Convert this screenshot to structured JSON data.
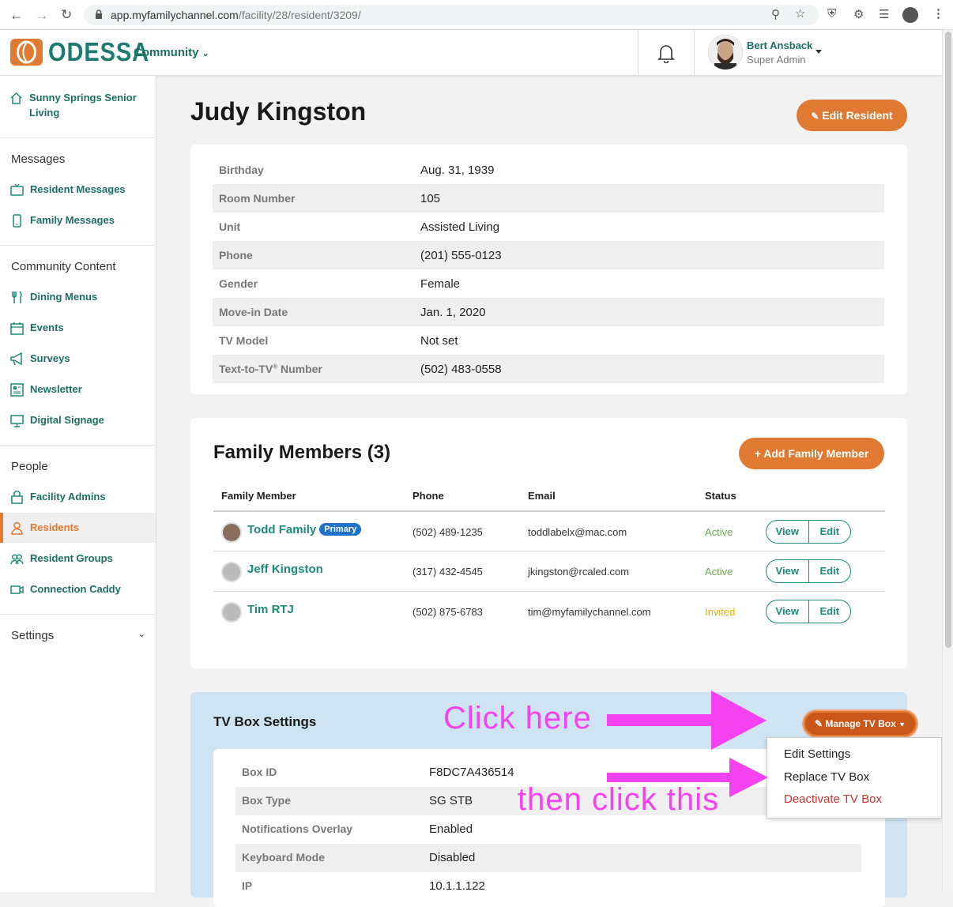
{
  "browser": {
    "url_host": "app.myfamilychannel.com",
    "url_path": "/facility/28/resident/3209/"
  },
  "header": {
    "logo_text": "ODESSA",
    "community_label": "Community",
    "user_name": "Bert Ansback",
    "user_role": "Super Admin"
  },
  "sidebar": {
    "facility": "Sunny Springs Senior Living",
    "sections": {
      "messages": "Messages",
      "community_content": "Community Content",
      "people": "People",
      "settings": "Settings"
    },
    "items": {
      "resident_messages": "Resident Messages",
      "family_messages": "Family Messages",
      "dining_menus": "Dining Menus",
      "events": "Events",
      "surveys": "Surveys",
      "newsletter": "Newsletter",
      "digital_signage": "Digital Signage",
      "facility_admins": "Facility Admins",
      "residents": "Residents",
      "resident_groups": "Resident Groups",
      "connection_caddy": "Connection Caddy"
    }
  },
  "resident": {
    "name": "Judy Kingston",
    "edit_button": "Edit Resident",
    "fields": [
      {
        "label": "Birthday",
        "value": "Aug. 31, 1939"
      },
      {
        "label": "Room Number",
        "value": "105"
      },
      {
        "label": "Unit",
        "value": "Assisted Living"
      },
      {
        "label": "Phone",
        "value": "(201) 555-0123"
      },
      {
        "label": "Gender",
        "value": "Female"
      },
      {
        "label": "Move-in Date",
        "value": "Jan. 1, 2020"
      },
      {
        "label": "TV Model",
        "value": "Not set"
      },
      {
        "label": "Text-to-TV",
        "label_sup": "®",
        "label_suffix": " Number",
        "value": "(502) 483-0558"
      }
    ]
  },
  "family": {
    "title": "Family Members (3)",
    "add_button": "Add Family Member",
    "headers": {
      "member": "Family Member",
      "phone": "Phone",
      "email": "Email",
      "status": "Status"
    },
    "view_label": "View",
    "edit_label": "Edit",
    "rows": [
      {
        "name": "Todd Family",
        "badge": "Primary",
        "phone": "(502) 489-1235",
        "email": "toddlabelx@mac.com",
        "status": "Active",
        "status_color": "#6aa84f"
      },
      {
        "name": "Jeff Kingston",
        "phone": "(317) 432-4545",
        "email": "jkingston@rcaled.com",
        "status": "Active",
        "status_color": "#6aa84f"
      },
      {
        "name": "Tim RTJ",
        "phone": "(502) 875-6783",
        "email": "tim@myfamilychannel.com",
        "status": "Invited",
        "status_color": "#e8b400"
      }
    ]
  },
  "tvbox": {
    "title": "TV Box Settings",
    "manage_button": "Manage TV Box",
    "fields": [
      {
        "label": "Box ID",
        "value": "F8DC7A436514"
      },
      {
        "label": "Box Type",
        "value": "SG STB"
      },
      {
        "label": "Notifications Overlay",
        "value": "Enabled"
      },
      {
        "label": "Keyboard Mode",
        "value": "Disabled"
      },
      {
        "label": "IP",
        "value": "10.1.1.122"
      }
    ],
    "menu": {
      "edit_settings": "Edit Settings",
      "replace": "Replace TV Box",
      "deactivate": "Deactivate TV Box"
    }
  },
  "annotations": {
    "click_here": "Click here",
    "then_click": "then click this"
  },
  "colors": {
    "accent_orange": "#e07a32",
    "brand_teal": "#1d6e63",
    "annotation_magenta": "#f542f0",
    "danger": "#d0312d"
  }
}
